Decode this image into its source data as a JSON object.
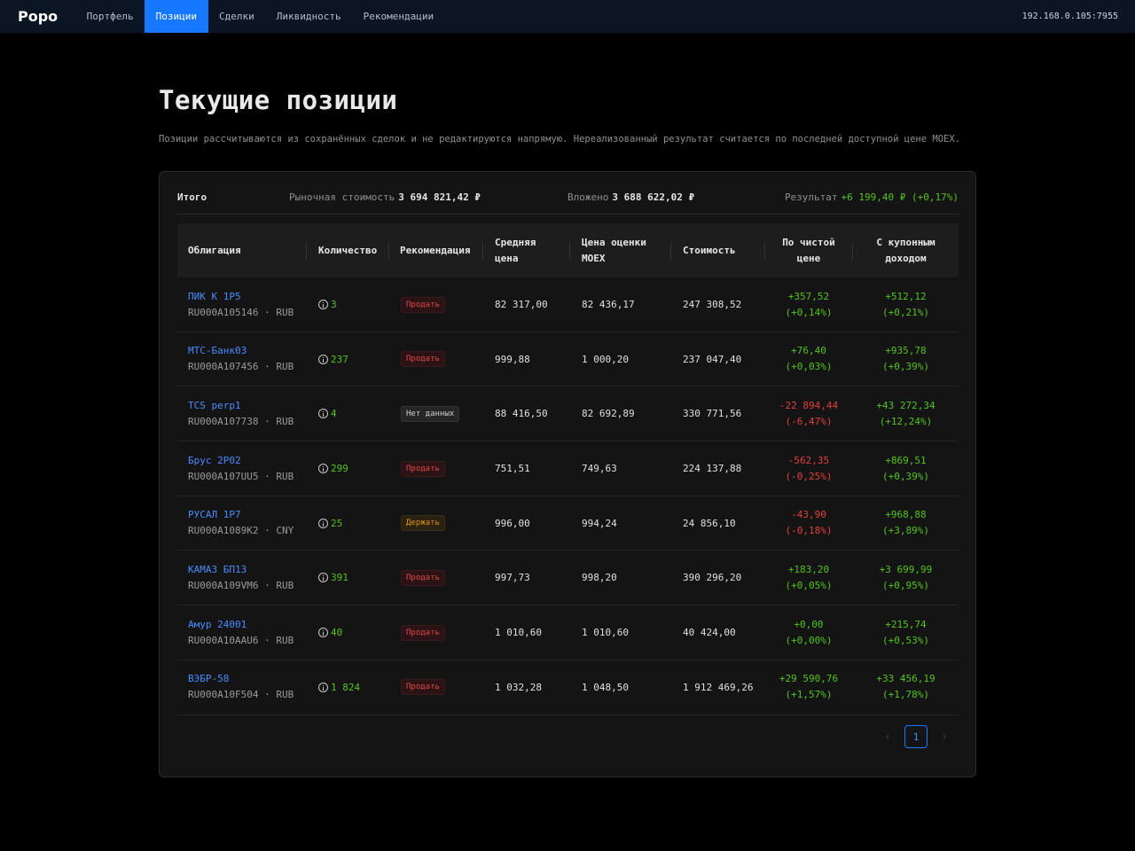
{
  "app": {
    "brand": "Popo",
    "host": "192.168.0.105:7955"
  },
  "nav": [
    {
      "label": "Портфель",
      "active": false
    },
    {
      "label": "Позиции",
      "active": true
    },
    {
      "label": "Сделки",
      "active": false
    },
    {
      "label": "Ликвидность",
      "active": false
    },
    {
      "label": "Рекомендации",
      "active": false
    }
  ],
  "page": {
    "title": "Текущие позиции",
    "description": "Позиции рассчитываются из сохранённых сделок и не редактируются напрямую. Нереализованный результат считается по последней доступной цене MOEX."
  },
  "summary": {
    "total_label": "Итого",
    "market_label": "Рыночная стоимость",
    "market_value": "3 694 821,42 ₽",
    "invested_label": "Вложено",
    "invested_value": "3 688 622,02 ₽",
    "result_label": "Результат",
    "result_value": "+6 199,40 ₽ (+0,17%)"
  },
  "table": {
    "headers": {
      "bond": "Облигация",
      "qty": "Количество",
      "rec": "Рекомендация",
      "avg_line1": "Средняя",
      "avg_line2": "цена",
      "moex_line1": "Цена оценки",
      "moex_line2": "MOEX",
      "value": "Стоимость",
      "clean_line1": "По чистой",
      "clean_line2": "цене",
      "coupon_line1": "С купонным",
      "coupon_line2": "доходом"
    },
    "rows": [
      {
        "name": "ПИК К 1Р5",
        "isin": "RU000A105146 · RUB",
        "qty": "3",
        "rec": "Продать",
        "rec_type": "sell",
        "avg": "82 317,00",
        "moex": "82 436,17",
        "value": "247 308,52",
        "clean": "+357,52",
        "clean_pct": "(+0,14%)",
        "clean_sign": "pos",
        "coupon": "+512,12",
        "coupon_pct": "(+0,21%)",
        "coupon_sign": "pos"
      },
      {
        "name": "МТС-Банк03",
        "isin": "RU000A107456 · RUB",
        "qty": "237",
        "rec": "Продать",
        "rec_type": "sell",
        "avg": "999,88",
        "moex": "1 000,20",
        "value": "237 047,40",
        "clean": "+76,40",
        "clean_pct": "(+0,03%)",
        "clean_sign": "pos",
        "coupon": "+935,78",
        "coupon_pct": "(+0,39%)",
        "coupon_sign": "pos"
      },
      {
        "name": "TCS perp1",
        "isin": "RU000A107738 · RUB",
        "qty": "4",
        "rec": "Нет данных",
        "rec_type": "none",
        "avg": "88 416,50",
        "moex": "82 692,89",
        "value": "330 771,56",
        "clean": "-22 894,44",
        "clean_pct": "(-6,47%)",
        "clean_sign": "neg",
        "coupon": "+43 272,34",
        "coupon_pct": "(+12,24%)",
        "coupon_sign": "pos"
      },
      {
        "name": "Брус 2Р02",
        "isin": "RU000A107UU5 · RUB",
        "qty": "299",
        "rec": "Продать",
        "rec_type": "sell",
        "avg": "751,51",
        "moex": "749,63",
        "value": "224 137,88",
        "clean": "-562,35",
        "clean_pct": "(-0,25%)",
        "clean_sign": "neg",
        "coupon": "+869,51",
        "coupon_pct": "(+0,39%)",
        "coupon_sign": "pos"
      },
      {
        "name": "РУСАЛ 1Р7",
        "isin": "RU000A1089K2 · CNY",
        "qty": "25",
        "rec": "Держать",
        "rec_type": "hold",
        "avg": "996,00",
        "moex": "994,24",
        "value": "24 856,10",
        "clean": "-43,90",
        "clean_pct": "(-0,18%)",
        "clean_sign": "neg",
        "coupon": "+968,88",
        "coupon_pct": "(+3,89%)",
        "coupon_sign": "pos"
      },
      {
        "name": "КАМАЗ БП13",
        "isin": "RU000A109VM6 · RUB",
        "qty": "391",
        "rec": "Продать",
        "rec_type": "sell",
        "avg": "997,73",
        "moex": "998,20",
        "value": "390 296,20",
        "clean": "+183,20",
        "clean_pct": "(+0,05%)",
        "clean_sign": "pos",
        "coupon": "+3 699,99",
        "coupon_pct": "(+0,95%)",
        "coupon_sign": "pos"
      },
      {
        "name": "Амур 24001",
        "isin": "RU000A10AAU6 · RUB",
        "qty": "40",
        "rec": "Продать",
        "rec_type": "sell",
        "avg": "1 010,60",
        "moex": "1 010,60",
        "value": "40 424,00",
        "clean": "+0,00",
        "clean_pct": "(+0,00%)",
        "clean_sign": "pos",
        "coupon": "+215,74",
        "coupon_pct": "(+0,53%)",
        "coupon_sign": "pos"
      },
      {
        "name": "ВЭБР-58",
        "isin": "RU000A10F504 · RUB",
        "qty": "1 824",
        "rec": "Продать",
        "rec_type": "sell",
        "avg": "1 032,28",
        "moex": "1 048,50",
        "value": "1 912 469,26",
        "clean": "+29 590,76",
        "clean_pct": "(+1,57%)",
        "clean_sign": "pos",
        "coupon": "+33 456,19",
        "coupon_pct": "(+1,78%)",
        "coupon_sign": "pos"
      }
    ]
  },
  "pagination": {
    "current": "1",
    "prev_icon": "chevron-left-icon",
    "next_icon": "chevron-right-icon"
  },
  "colors": {
    "accent": "#1677ff",
    "positive": "#52c41a",
    "negative": "#e0403d",
    "link": "#4a8cff",
    "hold": "#d89614"
  }
}
